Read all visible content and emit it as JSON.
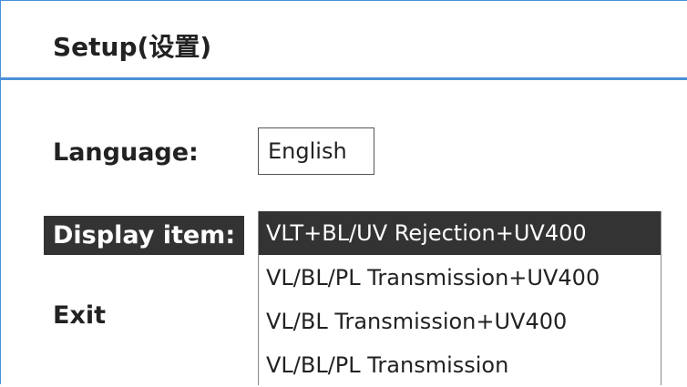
{
  "header": {
    "title": "Setup(设置)"
  },
  "settings": {
    "language_label": "Language:",
    "language_value": "English",
    "display_label": "Display item:",
    "exit_label": "Exit"
  },
  "display_items": {
    "selected_index": 0,
    "options": [
      "VLT+BL/UV Rejection+UV400",
      "VL/BL/PL Transmission+UV400",
      "VL/BL Transmission+UV400",
      "VL/BL/PL Transmission"
    ]
  },
  "colors": {
    "accent": "#4a90d9",
    "highlight_bg": "#333333",
    "highlight_text": "#ffffff"
  }
}
